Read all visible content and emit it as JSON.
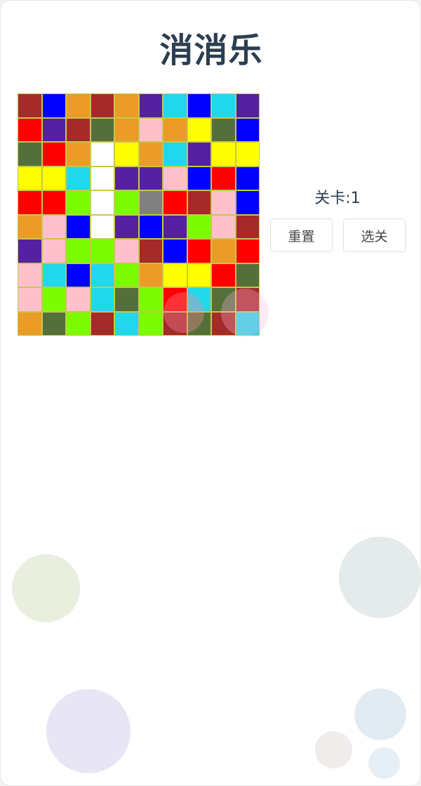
{
  "game": {
    "title": "消消乐",
    "level_text": "关卡:1",
    "reset_label": "重置",
    "select_level_label": "选关"
  },
  "palette": {
    "M": "#a52a2a",
    "B": "#0000ff",
    "O": "#eb9c27",
    "P": "#5521a0",
    "C": "#20d8eb",
    "R": "#ff0000",
    "G": "#556f3b",
    "K": "#ffc0cb",
    "Y": "#ffff00",
    "W": "#ffffff",
    "L": "#7cfc00",
    "S": "#808080"
  },
  "board": [
    [
      "M",
      "B",
      "O",
      "M",
      "O",
      "P",
      "C",
      "B",
      "C",
      "P"
    ],
    [
      "R",
      "P",
      "M",
      "G",
      "O",
      "K",
      "O",
      "Y",
      "G",
      "B"
    ],
    [
      "G",
      "R",
      "O",
      "W",
      "Y",
      "O",
      "C",
      "P",
      "Y",
      "Y"
    ],
    [
      "Y",
      "Y",
      "C",
      "W",
      "P",
      "P",
      "K",
      "B",
      "R",
      "B"
    ],
    [
      "R",
      "R",
      "L",
      "W",
      "L",
      "S",
      "R",
      "M",
      "K",
      "B"
    ],
    [
      "O",
      "K",
      "B",
      "W",
      "P",
      "B",
      "P",
      "L",
      "K",
      "M"
    ],
    [
      "P",
      "K",
      "L",
      "L",
      "K",
      "M",
      "B",
      "R",
      "O",
      "R"
    ],
    [
      "K",
      "C",
      "B",
      "C",
      "L",
      "O",
      "Y",
      "Y",
      "R",
      "G"
    ],
    [
      "K",
      "L",
      "K",
      "C",
      "G",
      "L",
      "R",
      "C",
      "G",
      "M"
    ],
    [
      "O",
      "G",
      "L",
      "M",
      "C",
      "L",
      "M",
      "G",
      "M",
      "C"
    ]
  ],
  "bubbles": [
    {
      "color": "#e8efde"
    },
    {
      "color": "#e5eaea"
    },
    {
      "color": "#e8e6f4"
    },
    {
      "color": "#e3ebf2"
    },
    {
      "color": "#f1ecec"
    },
    {
      "color": "#e6eff6"
    },
    {
      "color": "#ff89a0"
    },
    {
      "color": "#ffb6d9"
    }
  ]
}
